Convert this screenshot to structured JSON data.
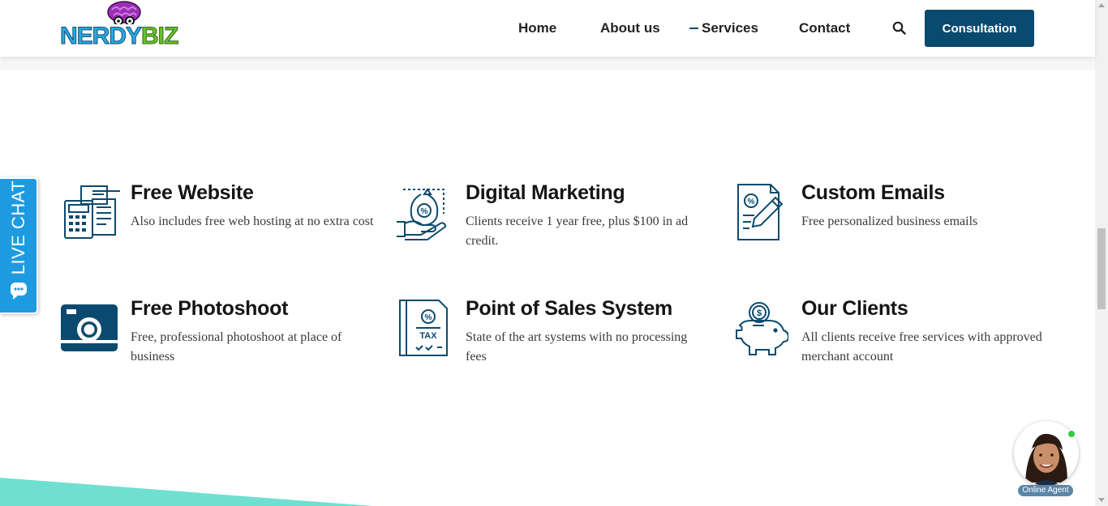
{
  "header": {
    "logo": {
      "part1": "NERDY",
      "part2": "BIZ"
    },
    "nav": [
      {
        "label": "Home"
      },
      {
        "label": "About us"
      },
      {
        "label": "Services"
      },
      {
        "label": "Contact"
      }
    ],
    "consultation_label": "Consultation"
  },
  "livechat": {
    "label": "LIVE CHAT"
  },
  "features": [
    {
      "title": "Free Website",
      "desc": "Also includes free web hosting at no extra cost",
      "icon": "calculator-invoice-icon"
    },
    {
      "title": "Digital Marketing",
      "desc": "Clients receive 1 year free, plus $100 in ad credit.",
      "icon": "money-bag-hand-icon"
    },
    {
      "title": "Custom Emails",
      "desc": "Free personalized business emails",
      "icon": "document-pen-icon"
    },
    {
      "title": "Free Photoshoot",
      "desc": "Free, professional photoshoot at place of business",
      "icon": "camera-icon"
    },
    {
      "title": "Point of Sales System",
      "desc": "State of the art systems with no processing fees",
      "icon": "tax-document-icon"
    },
    {
      "title": "Our Clients",
      "desc": "All clients receive free services with approved merchant account",
      "icon": "piggy-bank-icon"
    }
  ],
  "agent": {
    "label": "Online Agent",
    "status": "online"
  },
  "colors": {
    "brand_dark": "#0b4a6f",
    "icon": "#0b4a6f",
    "livechat": "#1e9be0",
    "teal": "#6fe0d0",
    "online": "#2ecc40"
  }
}
